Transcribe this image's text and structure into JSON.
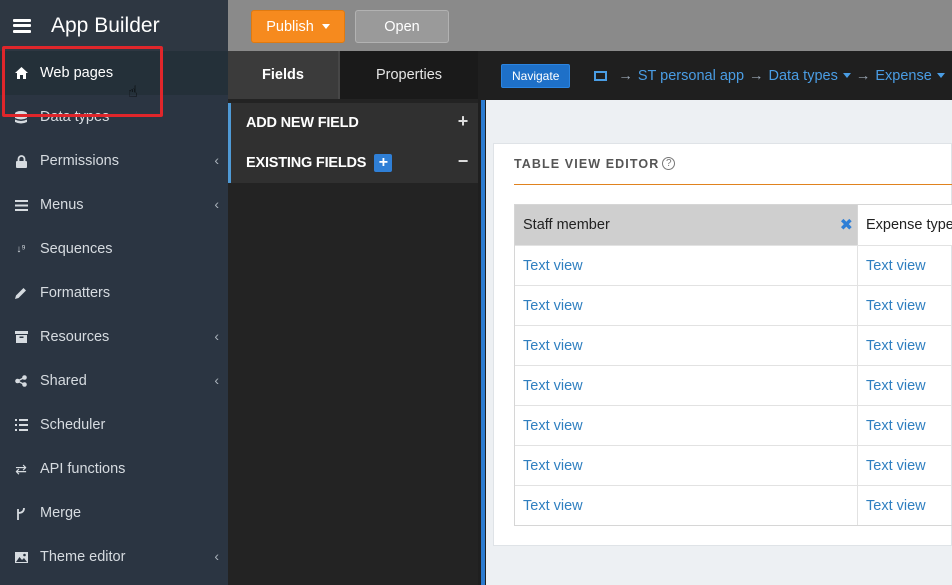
{
  "app": {
    "title": "App Builder"
  },
  "sidebar": {
    "items": [
      {
        "label": "Web pages",
        "icon": "home-icon",
        "has_submenu": false,
        "active": true
      },
      {
        "label": "Data types",
        "icon": "database-icon",
        "has_submenu": false
      },
      {
        "label": "Permissions",
        "icon": "lock-icon",
        "has_submenu": true
      },
      {
        "label": "Menus",
        "icon": "list-icon",
        "has_submenu": true
      },
      {
        "label": "Sequences",
        "icon": "sort-numeric-icon",
        "has_submenu": false
      },
      {
        "label": "Formatters",
        "icon": "pencil-icon",
        "has_submenu": false
      },
      {
        "label": "Resources",
        "icon": "archive-icon",
        "has_submenu": true
      },
      {
        "label": "Shared",
        "icon": "share-icon",
        "has_submenu": true
      },
      {
        "label": "Scheduler",
        "icon": "tasks-icon",
        "has_submenu": false
      },
      {
        "label": "API functions",
        "icon": "exchange-icon",
        "has_submenu": false
      },
      {
        "label": "Merge",
        "icon": "merge-icon",
        "has_submenu": false
      },
      {
        "label": "Theme editor",
        "icon": "image-icon",
        "has_submenu": true
      }
    ]
  },
  "toolbar": {
    "publish_label": "Publish",
    "open_label": "Open"
  },
  "panel": {
    "tabs": [
      {
        "label": "Fields",
        "active": true
      },
      {
        "label": "Properties",
        "active": false
      }
    ],
    "add_new_field": "ADD NEW FIELD",
    "existing_fields": "EXISTING FIELDS"
  },
  "breadcrumb": {
    "navigate_label": "Navigate",
    "items": [
      "ST personal app",
      "Data types",
      "Expense"
    ]
  },
  "editor": {
    "title": "TABLE VIEW EDITOR",
    "columns": [
      "Staff member",
      "Expense type"
    ],
    "rows": [
      [
        "Text view",
        "Text view"
      ],
      [
        "Text view",
        "Text view"
      ],
      [
        "Text view",
        "Text view"
      ],
      [
        "Text view",
        "Text view"
      ],
      [
        "Text view",
        "Text view"
      ],
      [
        "Text view",
        "Text view"
      ],
      [
        "Text view",
        "Text view"
      ]
    ]
  },
  "colors": {
    "accent": "#f68a1e",
    "link": "#2f7fc0",
    "highlight": "#e0262b",
    "nav": "#1e70c8"
  }
}
